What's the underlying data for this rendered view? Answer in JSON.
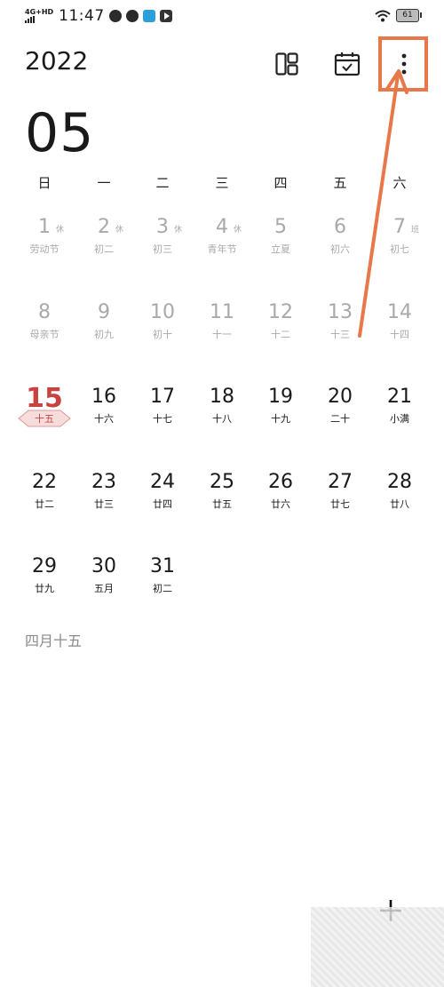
{
  "status": {
    "network": "4G+HD",
    "time": "11:47",
    "battery": "61"
  },
  "header": {
    "year": "2022",
    "month": "05",
    "icons": [
      "layout-icon",
      "calendar-today-icon",
      "more-vertical-icon"
    ]
  },
  "weekdays": [
    "日",
    "一",
    "二",
    "三",
    "四",
    "五",
    "六"
  ],
  "days": [
    {
      "num": "1",
      "lunar": "劳动节",
      "rest": "休",
      "state": "past"
    },
    {
      "num": "2",
      "lunar": "初二",
      "rest": "休",
      "state": "past"
    },
    {
      "num": "3",
      "lunar": "初三",
      "rest": "休",
      "state": "past"
    },
    {
      "num": "4",
      "lunar": "青年节",
      "rest": "休",
      "state": "past"
    },
    {
      "num": "5",
      "lunar": "立夏",
      "rest": "",
      "state": "past"
    },
    {
      "num": "6",
      "lunar": "初六",
      "rest": "",
      "state": "past"
    },
    {
      "num": "7",
      "lunar": "初七",
      "rest": "班",
      "state": "past"
    },
    {
      "num": "8",
      "lunar": "母亲节",
      "rest": "",
      "state": "past"
    },
    {
      "num": "9",
      "lunar": "初九",
      "rest": "",
      "state": "past"
    },
    {
      "num": "10",
      "lunar": "初十",
      "rest": "",
      "state": "past"
    },
    {
      "num": "11",
      "lunar": "十一",
      "rest": "",
      "state": "past"
    },
    {
      "num": "12",
      "lunar": "十二",
      "rest": "",
      "state": "past"
    },
    {
      "num": "13",
      "lunar": "十三",
      "rest": "",
      "state": "past"
    },
    {
      "num": "14",
      "lunar": "十四",
      "rest": "",
      "state": "past"
    },
    {
      "num": "15",
      "lunar": "十五",
      "rest": "",
      "state": "today"
    },
    {
      "num": "16",
      "lunar": "十六",
      "rest": "",
      "state": "normal"
    },
    {
      "num": "17",
      "lunar": "十七",
      "rest": "",
      "state": "normal"
    },
    {
      "num": "18",
      "lunar": "十八",
      "rest": "",
      "state": "normal"
    },
    {
      "num": "19",
      "lunar": "十九",
      "rest": "",
      "state": "normal"
    },
    {
      "num": "20",
      "lunar": "二十",
      "rest": "",
      "state": "normal"
    },
    {
      "num": "21",
      "lunar": "小满",
      "rest": "",
      "state": "normal"
    },
    {
      "num": "22",
      "lunar": "廿二",
      "rest": "",
      "state": "normal"
    },
    {
      "num": "23",
      "lunar": "廿三",
      "rest": "",
      "state": "normal"
    },
    {
      "num": "24",
      "lunar": "廿四",
      "rest": "",
      "state": "normal"
    },
    {
      "num": "25",
      "lunar": "廿五",
      "rest": "",
      "state": "normal"
    },
    {
      "num": "26",
      "lunar": "廿六",
      "rest": "",
      "state": "normal"
    },
    {
      "num": "27",
      "lunar": "廿七",
      "rest": "",
      "state": "normal"
    },
    {
      "num": "28",
      "lunar": "廿八",
      "rest": "",
      "state": "normal"
    },
    {
      "num": "29",
      "lunar": "廿九",
      "rest": "",
      "state": "normal"
    },
    {
      "num": "30",
      "lunar": "五月",
      "rest": "",
      "state": "normal"
    },
    {
      "num": "31",
      "lunar": "初二",
      "rest": "",
      "state": "normal"
    }
  ],
  "selected_lunar": "四月十五",
  "colors": {
    "today": "#c9423f",
    "annotation": "#e8784a",
    "past": "#a9a9a9"
  }
}
